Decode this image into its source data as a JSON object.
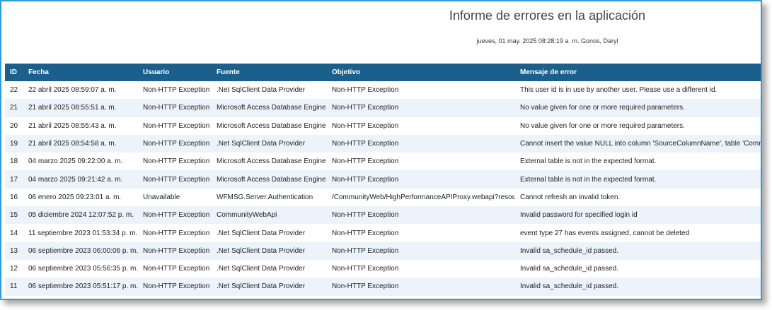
{
  "report": {
    "title": "Informe de errores en la aplicación",
    "subtitle": "jueves, 01 may. 2025 08:28:19 a. m. Gonos, Daryl"
  },
  "columns": {
    "id": "ID",
    "fecha": "Fecha",
    "usuario": "Usuario",
    "fuente": "Fuente",
    "objetivo": "Objetivo",
    "mensaje": "Mensaje de error"
  },
  "colors": {
    "header_bg": "#1b5f8c",
    "row_alt_bg": "#edf3fa",
    "frame_border": "#2d9be0"
  },
  "rows": [
    {
      "id": "22",
      "fecha": "22 abril 2025 08:59:07 a. m.",
      "usuario": "Non-HTTP Exception",
      "fuente": ".Net SqlClient Data Provider",
      "objetivo": "Non-HTTP Exception",
      "mensaje": "This user id is in use by another user. Please use a different id."
    },
    {
      "id": "21",
      "fecha": "21 abril 2025 08:55:51 a. m.",
      "usuario": "Non-HTTP Exception",
      "fuente": "Microsoft Access Database Engine",
      "objetivo": "Non-HTTP Exception",
      "mensaje": "No value given for one or more required parameters."
    },
    {
      "id": "20",
      "fecha": "21 abril 2025 08:55:43 a. m.",
      "usuario": "Non-HTTP Exception",
      "fuente": "Microsoft Access Database Engine",
      "objetivo": "Non-HTTP Exception",
      "mensaje": "No value given for one or more required parameters."
    },
    {
      "id": "19",
      "fecha": "21 abril 2025 08:54:58 a. m.",
      "usuario": "Non-HTTP Exception",
      "fuente": ".Net SqlClient Data Provider",
      "objetivo": "Non-HTTP Exception",
      "mensaje": "Cannot insert the value NULL into column 'SourceColumnName', table 'Communi"
    },
    {
      "id": "18",
      "fecha": "04 marzo 2025 09:22:00 a. m.",
      "usuario": "Non-HTTP Exception",
      "fuente": "Microsoft Access Database Engine",
      "objetivo": "Non-HTTP Exception",
      "mensaje": "External table is not in the expected format."
    },
    {
      "id": "17",
      "fecha": "04 marzo 2025 09:21:42 a. m.",
      "usuario": "Non-HTTP Exception",
      "fuente": "Microsoft Access Database Engine",
      "objetivo": "Non-HTTP Exception",
      "mensaje": "External table is not in the expected format."
    },
    {
      "id": "16",
      "fecha": "06 enero 2025 09:23:01 a. m.",
      "usuario": "Unavailable",
      "fuente": "WFMSG.Server.Authentication",
      "objetivo": "/CommunityWeb/HighPerformanceAPIProxy.webapi?resou",
      "mensaje": "Cannot refresh an invalid token."
    },
    {
      "id": "15",
      "fecha": "05 diciembre 2024 12:07:52 p. m.",
      "usuario": "Non-HTTP Exception",
      "fuente": "CommunityWebApi",
      "objetivo": "Non-HTTP Exception",
      "mensaje": "Invalid password for specified login id"
    },
    {
      "id": "14",
      "fecha": "11 septiembre 2023 01:53:34 p. m.",
      "usuario": "Non-HTTP Exception",
      "fuente": ".Net SqlClient Data Provider",
      "objetivo": "Non-HTTP Exception",
      "mensaje": "event type 27 has events assigned, cannot be deleted"
    },
    {
      "id": "13",
      "fecha": "06 septiembre 2023 06:00:06 p. m.",
      "usuario": "Non-HTTP Exception",
      "fuente": ".Net SqlClient Data Provider",
      "objetivo": "Non-HTTP Exception",
      "mensaje": "Invalid sa_schedule_id passed."
    },
    {
      "id": "12",
      "fecha": "06 septiembre 2023 05:56:35 p. m.",
      "usuario": "Non-HTTP Exception",
      "fuente": ".Net SqlClient Data Provider",
      "objetivo": "Non-HTTP Exception",
      "mensaje": "Invalid sa_schedule_id passed."
    },
    {
      "id": "11",
      "fecha": "06 septiembre 2023 05:51:17 p. m.",
      "usuario": "Non-HTTP Exception",
      "fuente": ".Net SqlClient Data Provider",
      "objetivo": "Non-HTTP Exception",
      "mensaje": "Invalid sa_schedule_id passed."
    }
  ]
}
